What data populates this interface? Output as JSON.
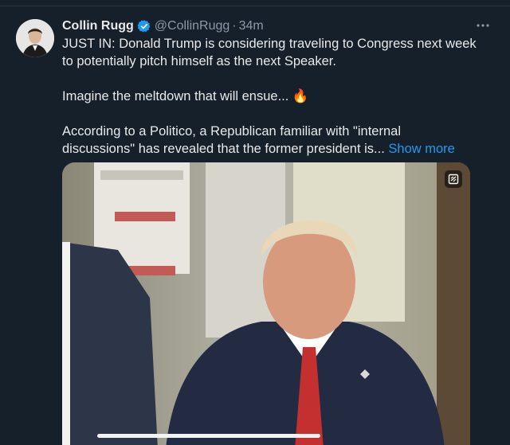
{
  "tweet": {
    "display_name": "Collin Rugg",
    "verified": true,
    "handle": "@CollinRugg",
    "separator": "·",
    "time": "34m",
    "text_line1": "JUST IN: Donald Trump is considering traveling to Congress next week to potentially pitch himself as the next Speaker.",
    "text_line2": "Imagine the meltdown that will ensue... 🔥",
    "text_line3": "According to a Politico, a Republican familiar with \"internal discussions\" has revealed that the former president is...",
    "show_more": "Show more"
  },
  "icons": {
    "verified": "verified-badge-icon",
    "more": "more-options-icon",
    "media_badge": "gif-badge-icon"
  },
  "colors": {
    "background": "#15202b",
    "link": "#1d9bf0",
    "verified": "#1d9bf0",
    "secondary_text": "#8b98a5"
  }
}
